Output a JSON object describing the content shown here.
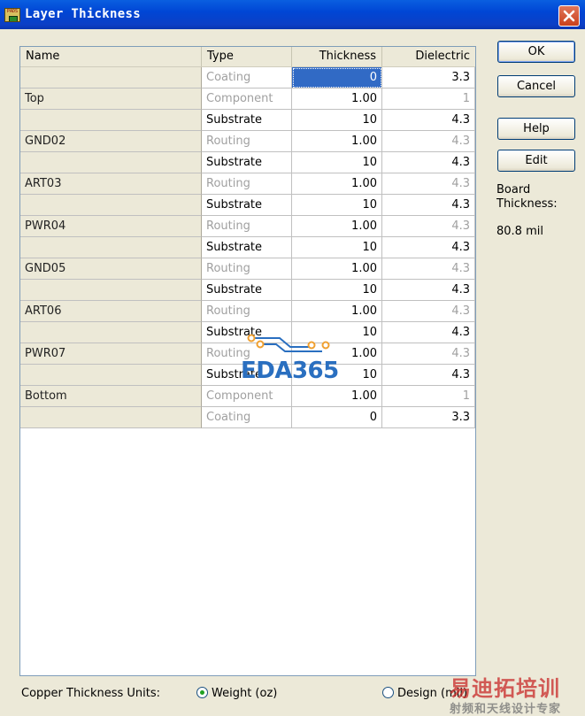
{
  "window": {
    "title": "Layer Thickness",
    "app_icon_text": "PADS"
  },
  "grid": {
    "headers": {
      "name": "Name",
      "type": "Type",
      "thickness": "Thickness",
      "dielectric": "Dielectric"
    },
    "rows": [
      {
        "name": "",
        "type": "Coating",
        "thickness": "0",
        "dielectric": "3.3",
        "type_gray": true,
        "diel_gray": false,
        "selected": true
      },
      {
        "name": "Top",
        "type": "Component",
        "thickness": "1.00",
        "dielectric": "1",
        "type_gray": true,
        "diel_gray": true
      },
      {
        "name": "",
        "type": "Substrate",
        "thickness": "10",
        "dielectric": "4.3",
        "type_gray": false,
        "diel_gray": false
      },
      {
        "name": "GND02",
        "type": "Routing",
        "thickness": "1.00",
        "dielectric": "4.3",
        "type_gray": true,
        "diel_gray": true
      },
      {
        "name": "",
        "type": "Substrate",
        "thickness": "10",
        "dielectric": "4.3",
        "type_gray": false,
        "diel_gray": false
      },
      {
        "name": "ART03",
        "type": "Routing",
        "thickness": "1.00",
        "dielectric": "4.3",
        "type_gray": true,
        "diel_gray": true
      },
      {
        "name": "",
        "type": "Substrate",
        "thickness": "10",
        "dielectric": "4.3",
        "type_gray": false,
        "diel_gray": false
      },
      {
        "name": "PWR04",
        "type": "Routing",
        "thickness": "1.00",
        "dielectric": "4.3",
        "type_gray": true,
        "diel_gray": true
      },
      {
        "name": "",
        "type": "Substrate",
        "thickness": "10",
        "dielectric": "4.3",
        "type_gray": false,
        "diel_gray": false
      },
      {
        "name": "GND05",
        "type": "Routing",
        "thickness": "1.00",
        "dielectric": "4.3",
        "type_gray": true,
        "diel_gray": true
      },
      {
        "name": "",
        "type": "Substrate",
        "thickness": "10",
        "dielectric": "4.3",
        "type_gray": false,
        "diel_gray": false
      },
      {
        "name": "ART06",
        "type": "Routing",
        "thickness": "1.00",
        "dielectric": "4.3",
        "type_gray": true,
        "diel_gray": true
      },
      {
        "name": "",
        "type": "Substrate",
        "thickness": "10",
        "dielectric": "4.3",
        "type_gray": false,
        "diel_gray": false
      },
      {
        "name": "PWR07",
        "type": "Routing",
        "thickness": "1.00",
        "dielectric": "4.3",
        "type_gray": true,
        "diel_gray": true
      },
      {
        "name": "",
        "type": "Substrate",
        "thickness": "10",
        "dielectric": "4.3",
        "type_gray": false,
        "diel_gray": false
      },
      {
        "name": "Bottom",
        "type": "Component",
        "thickness": "1.00",
        "dielectric": "1",
        "type_gray": true,
        "diel_gray": true
      },
      {
        "name": "",
        "type": "Coating",
        "thickness": "0",
        "dielectric": "3.3",
        "type_gray": true,
        "diel_gray": false
      }
    ]
  },
  "buttons": {
    "ok": "OK",
    "cancel": "Cancel",
    "help": "Help",
    "edit": "Edit"
  },
  "board": {
    "label_line1": "Board",
    "label_line2": "Thickness:",
    "value": "80.8 mil"
  },
  "units": {
    "label": "Copper Thickness Units:",
    "options": [
      {
        "label": "Weight (oz)",
        "selected": true
      },
      {
        "label": "Design (mil)",
        "selected": false
      }
    ]
  },
  "watermarks": {
    "logo": "EDA365",
    "cn_title": "易迪拓培训",
    "cn_sub": "射频和天线设计专家"
  },
  "colors": {
    "title_blue": "#0046d5",
    "selection": "#316ac5",
    "radio_green": "#21a121",
    "close_red": "#c9401c"
  }
}
